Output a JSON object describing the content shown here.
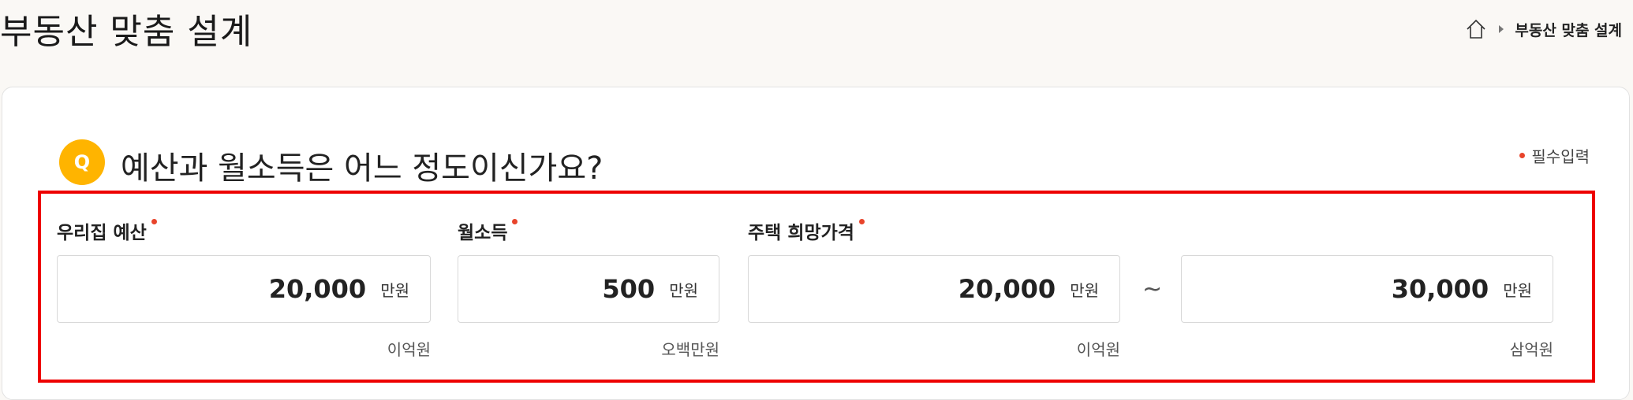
{
  "page": {
    "title": "부동산 맞춤 설계",
    "breadcrumb": {
      "home_icon": "home-icon",
      "current": "부동산 맞춤 설계"
    }
  },
  "question": {
    "badge": "Q",
    "text": "예산과 월소득은 어느 정도이신가요?",
    "required_note": "필수입력"
  },
  "fields": {
    "budget": {
      "label": "우리집 예산",
      "value": "20,000",
      "unit": "만원",
      "hangul": "이억원"
    },
    "income": {
      "label": "월소득",
      "value": "500",
      "unit": "만원",
      "hangul": "오백만원"
    },
    "price": {
      "label": "주택 희망가격",
      "min": {
        "value": "20,000",
        "unit": "만원",
        "hangul": "이억원"
      },
      "separator": "~",
      "max": {
        "value": "30,000",
        "unit": "만원",
        "hangul": "삼억원"
      }
    }
  },
  "colors": {
    "accent": "#ffb400",
    "required": "#e8442b",
    "highlight": "#ee0000"
  }
}
